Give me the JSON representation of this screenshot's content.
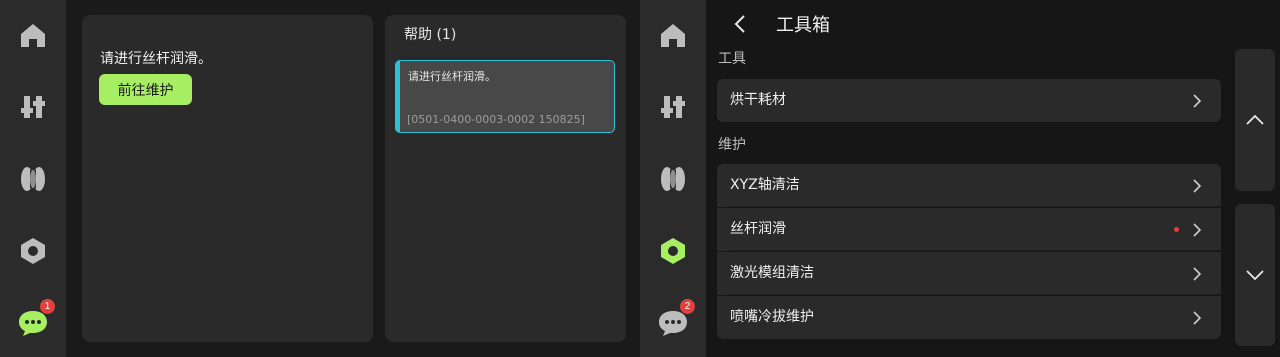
{
  "colors": {
    "accent_green": "#a7ee63",
    "badge_red": "#e0413c",
    "highlight_cyan": "#29c2d6"
  },
  "left_panel": {
    "nav": [
      {
        "icon": "home-icon"
      },
      {
        "icon": "sliders-icon"
      },
      {
        "icon": "filament-icon"
      },
      {
        "icon": "hex-nut-icon"
      },
      {
        "icon": "chat-icon",
        "badge": "1"
      }
    ],
    "message": "请进行丝杆润滑。",
    "goto_button": "前往维护",
    "help": {
      "title": "帮助 (1)",
      "items": [
        {
          "text": "请进行丝杆润滑。",
          "code": "[0501-0400-0003-0002 150825]"
        }
      ]
    }
  },
  "right_panel": {
    "nav": [
      {
        "icon": "home-icon"
      },
      {
        "icon": "sliders-icon"
      },
      {
        "icon": "filament-icon"
      },
      {
        "icon": "hex-nut-icon"
      },
      {
        "icon": "chat-icon",
        "badge": "2"
      }
    ],
    "title": "工具箱",
    "sections": [
      {
        "label": "工具",
        "items": [
          {
            "label": "烘干耗材"
          }
        ]
      },
      {
        "label": "维护",
        "items": [
          {
            "label": "XYZ轴清洁"
          },
          {
            "label": "丝杆润滑"
          },
          {
            "label": "激光模组清洁"
          },
          {
            "label": "喷嘴冷拔维护"
          }
        ]
      }
    ]
  }
}
